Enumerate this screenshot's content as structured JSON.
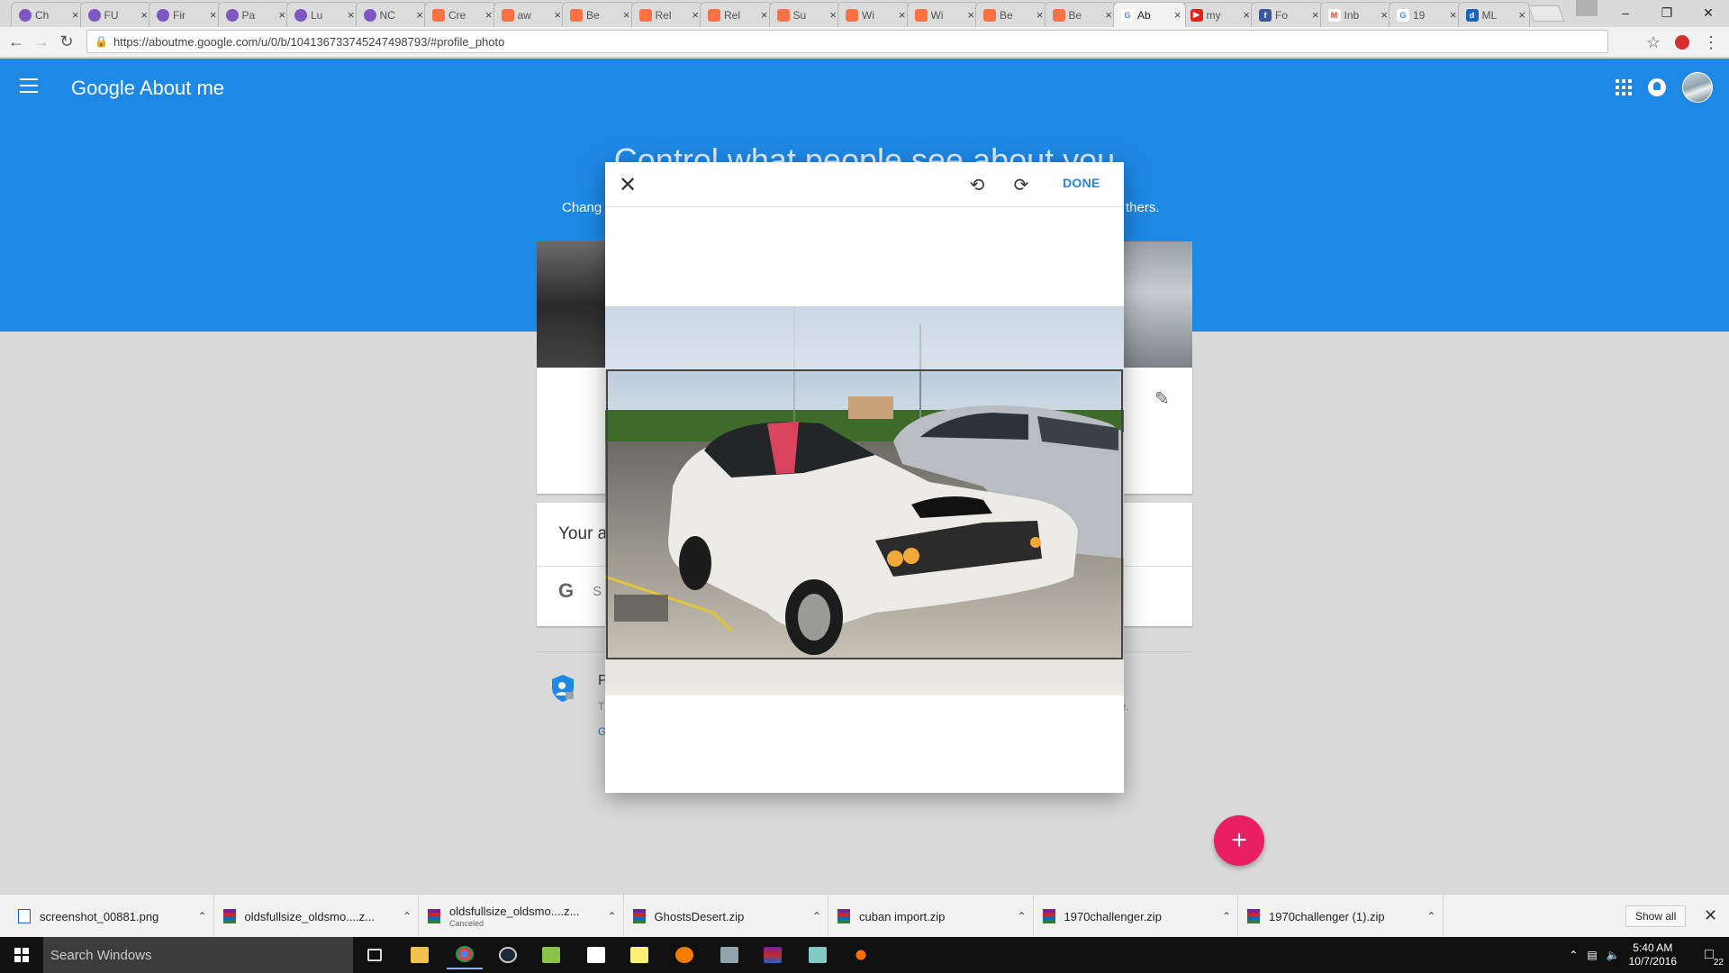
{
  "browser": {
    "tabs": [
      {
        "title": "Ch",
        "favicon": "purple-circle"
      },
      {
        "title": "FU",
        "favicon": "purple-circle"
      },
      {
        "title": "Fir",
        "favicon": "purple-circle"
      },
      {
        "title": "Pa",
        "favicon": "purple-circle"
      },
      {
        "title": "Lu",
        "favicon": "purple-circle"
      },
      {
        "title": "NC",
        "favicon": "purple-circle"
      },
      {
        "title": "Cre",
        "favicon": "orange-bolt"
      },
      {
        "title": "aw",
        "favicon": "orange-bolt"
      },
      {
        "title": "Be",
        "favicon": "orange-bolt"
      },
      {
        "title": "Rel",
        "favicon": "orange-bolt"
      },
      {
        "title": "Rel",
        "favicon": "orange-bolt"
      },
      {
        "title": "Su",
        "favicon": "orange-bolt"
      },
      {
        "title": "Wi",
        "favicon": "orange-bolt"
      },
      {
        "title": "Wi",
        "favicon": "orange-bolt"
      },
      {
        "title": "Be",
        "favicon": "orange-bolt"
      },
      {
        "title": "Be",
        "favicon": "orange-bolt"
      },
      {
        "title": "Ab",
        "favicon": "google-g",
        "active": true
      },
      {
        "title": "my",
        "favicon": "youtube"
      },
      {
        "title": "Fo",
        "favicon": "facebook"
      },
      {
        "title": "Inb",
        "favicon": "gmail"
      },
      {
        "title": "19",
        "favicon": "google-g"
      },
      {
        "title": "ML",
        "favicon": "blue-d"
      }
    ],
    "url": "https://aboutme.google.com/u/0/b/104136733745247498793/#profile_photo"
  },
  "app": {
    "brand_google": "Google",
    "brand_product": "About me",
    "hero_title": "Control what people see about you",
    "hero_sub_left": "Chang",
    "hero_sub_right": "thers."
  },
  "page": {
    "about_heading": "Your a",
    "search_partial": "S",
    "privacy_title": "P",
    "privacy_text_left": "T",
    "privacy_text_right": "e.",
    "privacy_link": "G"
  },
  "modal": {
    "done_label": "DONE"
  },
  "downloads": [
    {
      "name": "screenshot_00881.png",
      "type": "png"
    },
    {
      "name": "oldsfullsize_oldsmo....z...",
      "type": "zip"
    },
    {
      "name": "oldsfullsize_oldsmo....z...",
      "type": "zip",
      "status": "Canceled"
    },
    {
      "name": "GhostsDesert.zip",
      "type": "zip"
    },
    {
      "name": "cuban import.zip",
      "type": "zip"
    },
    {
      "name": "1970challenger.zip",
      "type": "zip"
    },
    {
      "name": "1970challenger (1).zip",
      "type": "zip"
    }
  ],
  "downloads_show_all": "Show all",
  "taskbar": {
    "search_placeholder": "Search Windows",
    "time": "5:40 AM",
    "date": "10/7/2016",
    "notification_count": "22"
  },
  "colors": {
    "header_blue": "#1e88e5",
    "fab_pink": "#e91e63"
  }
}
